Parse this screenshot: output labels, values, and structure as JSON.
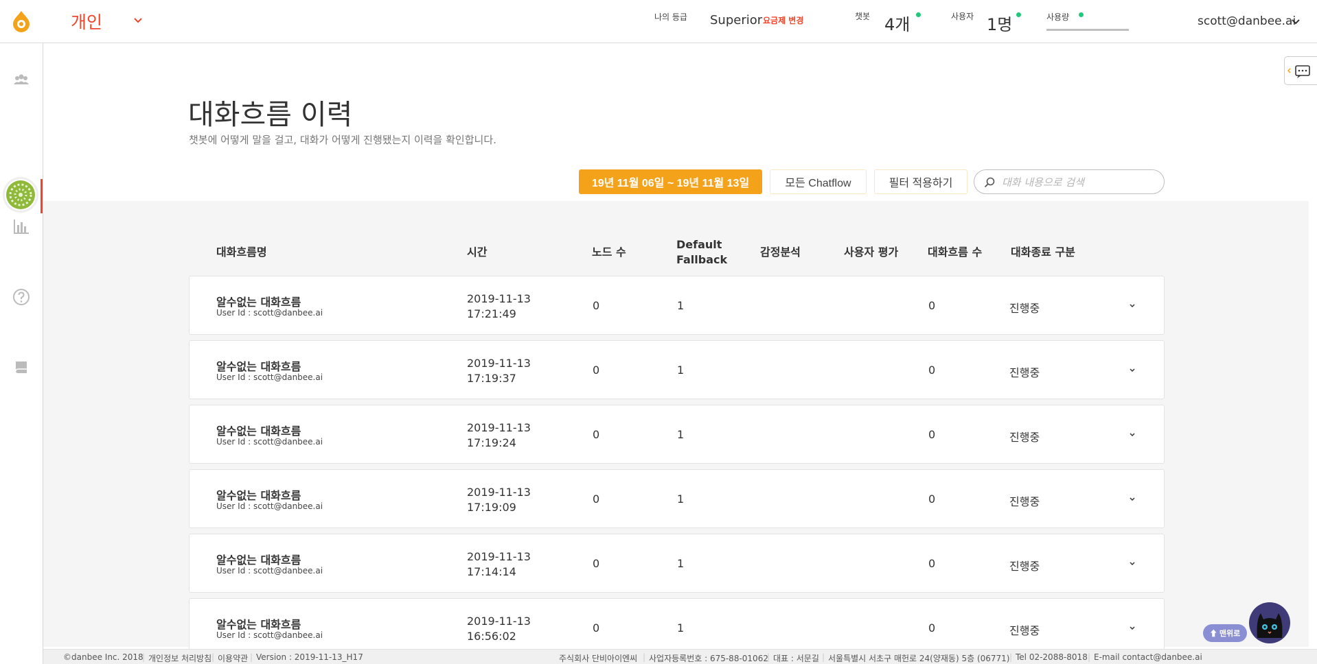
{
  "header": {
    "workspace": "개인",
    "grade_label": "나의 등급",
    "grade_value": "Superior",
    "plan_change_link": "요금제 변경",
    "chatbot_label": "챗봇",
    "chatbot_value": "4개",
    "users_label": "사용자",
    "users_value": "1명",
    "usage_label": "사용량",
    "user_email": "scott@danbee.ai",
    "status_color": "#21c77a",
    "accent_color": "#f0452b"
  },
  "page": {
    "title": "대화흐름 이력",
    "subtitle": "챗봇에 어떻게 말을 걸고, 대화가 어떻게 진행됐는지 이력을 확인합니다."
  },
  "toolbar": {
    "date_range": "19년 11월 06일 ~ 19년 11월 13일",
    "chatflow_filter": "모든 Chatflow",
    "apply_filter": "필터 적용하기",
    "search_placeholder": "대화 내용으로 검색",
    "date_button_color": "#f5a21b"
  },
  "table": {
    "headers": {
      "name": "대화흐름명",
      "time": "시간",
      "nodes": "노드 수",
      "fallback_1": "Default",
      "fallback_2": "Fallback",
      "sentiment": "감정분석",
      "rating": "사용자 평가",
      "flows": "대화흐름 수",
      "end_type": "대화종료 구분"
    },
    "rows": [
      {
        "name": "알수없는 대화흐름",
        "user": "User Id : scott@danbee.ai",
        "date": "2019-11-13",
        "time": "17:21:49",
        "nodes": "0",
        "fallback": "1",
        "flows": "0",
        "status": "진행중"
      },
      {
        "name": "알수없는 대화흐름",
        "user": "User Id : scott@danbee.ai",
        "date": "2019-11-13",
        "time": "17:19:37",
        "nodes": "0",
        "fallback": "1",
        "flows": "0",
        "status": "진행중"
      },
      {
        "name": "알수없는 대화흐름",
        "user": "User Id : scott@danbee.ai",
        "date": "2019-11-13",
        "time": "17:19:24",
        "nodes": "0",
        "fallback": "1",
        "flows": "0",
        "status": "진행중"
      },
      {
        "name": "알수없는 대화흐름",
        "user": "User Id : scott@danbee.ai",
        "date": "2019-11-13",
        "time": "17:19:09",
        "nodes": "0",
        "fallback": "1",
        "flows": "0",
        "status": "진행중"
      },
      {
        "name": "알수없는 대화흐름",
        "user": "User Id : scott@danbee.ai",
        "date": "2019-11-13",
        "time": "17:14:14",
        "nodes": "0",
        "fallback": "1",
        "flows": "0",
        "status": "진행중"
      },
      {
        "name": "알수없는 대화흐름",
        "user": "User Id : scott@danbee.ai",
        "date": "2019-11-13",
        "time": "16:56:02",
        "nodes": "0",
        "fallback": "1",
        "flows": "0",
        "status": "진행중"
      }
    ]
  },
  "footer": {
    "copyright": "©danbee Inc. 2018",
    "privacy": "개인정보 처리방침",
    "terms": "이용약관",
    "version": "Version : 2019-11-13_H17",
    "company": "주식회사 단비아이엔씨",
    "biz_no": "사업자등록번호 : 675-88-01062",
    "ceo": "대표 : 서문길",
    "address": "서울특별시 서초구 매헌로 24(양재동) 5층 (06771)",
    "tel": "Tel 02-2088-8018",
    "email": "E-mail contact@danbee.ai"
  },
  "widgets": {
    "to_top": "⬆ 맨위로"
  },
  "icons": [
    "logo-icon",
    "chevron-down-icon",
    "users-icon",
    "chart-icon",
    "help-icon",
    "book-icon",
    "search-icon",
    "chat-icon",
    "cat-avatar-icon"
  ]
}
